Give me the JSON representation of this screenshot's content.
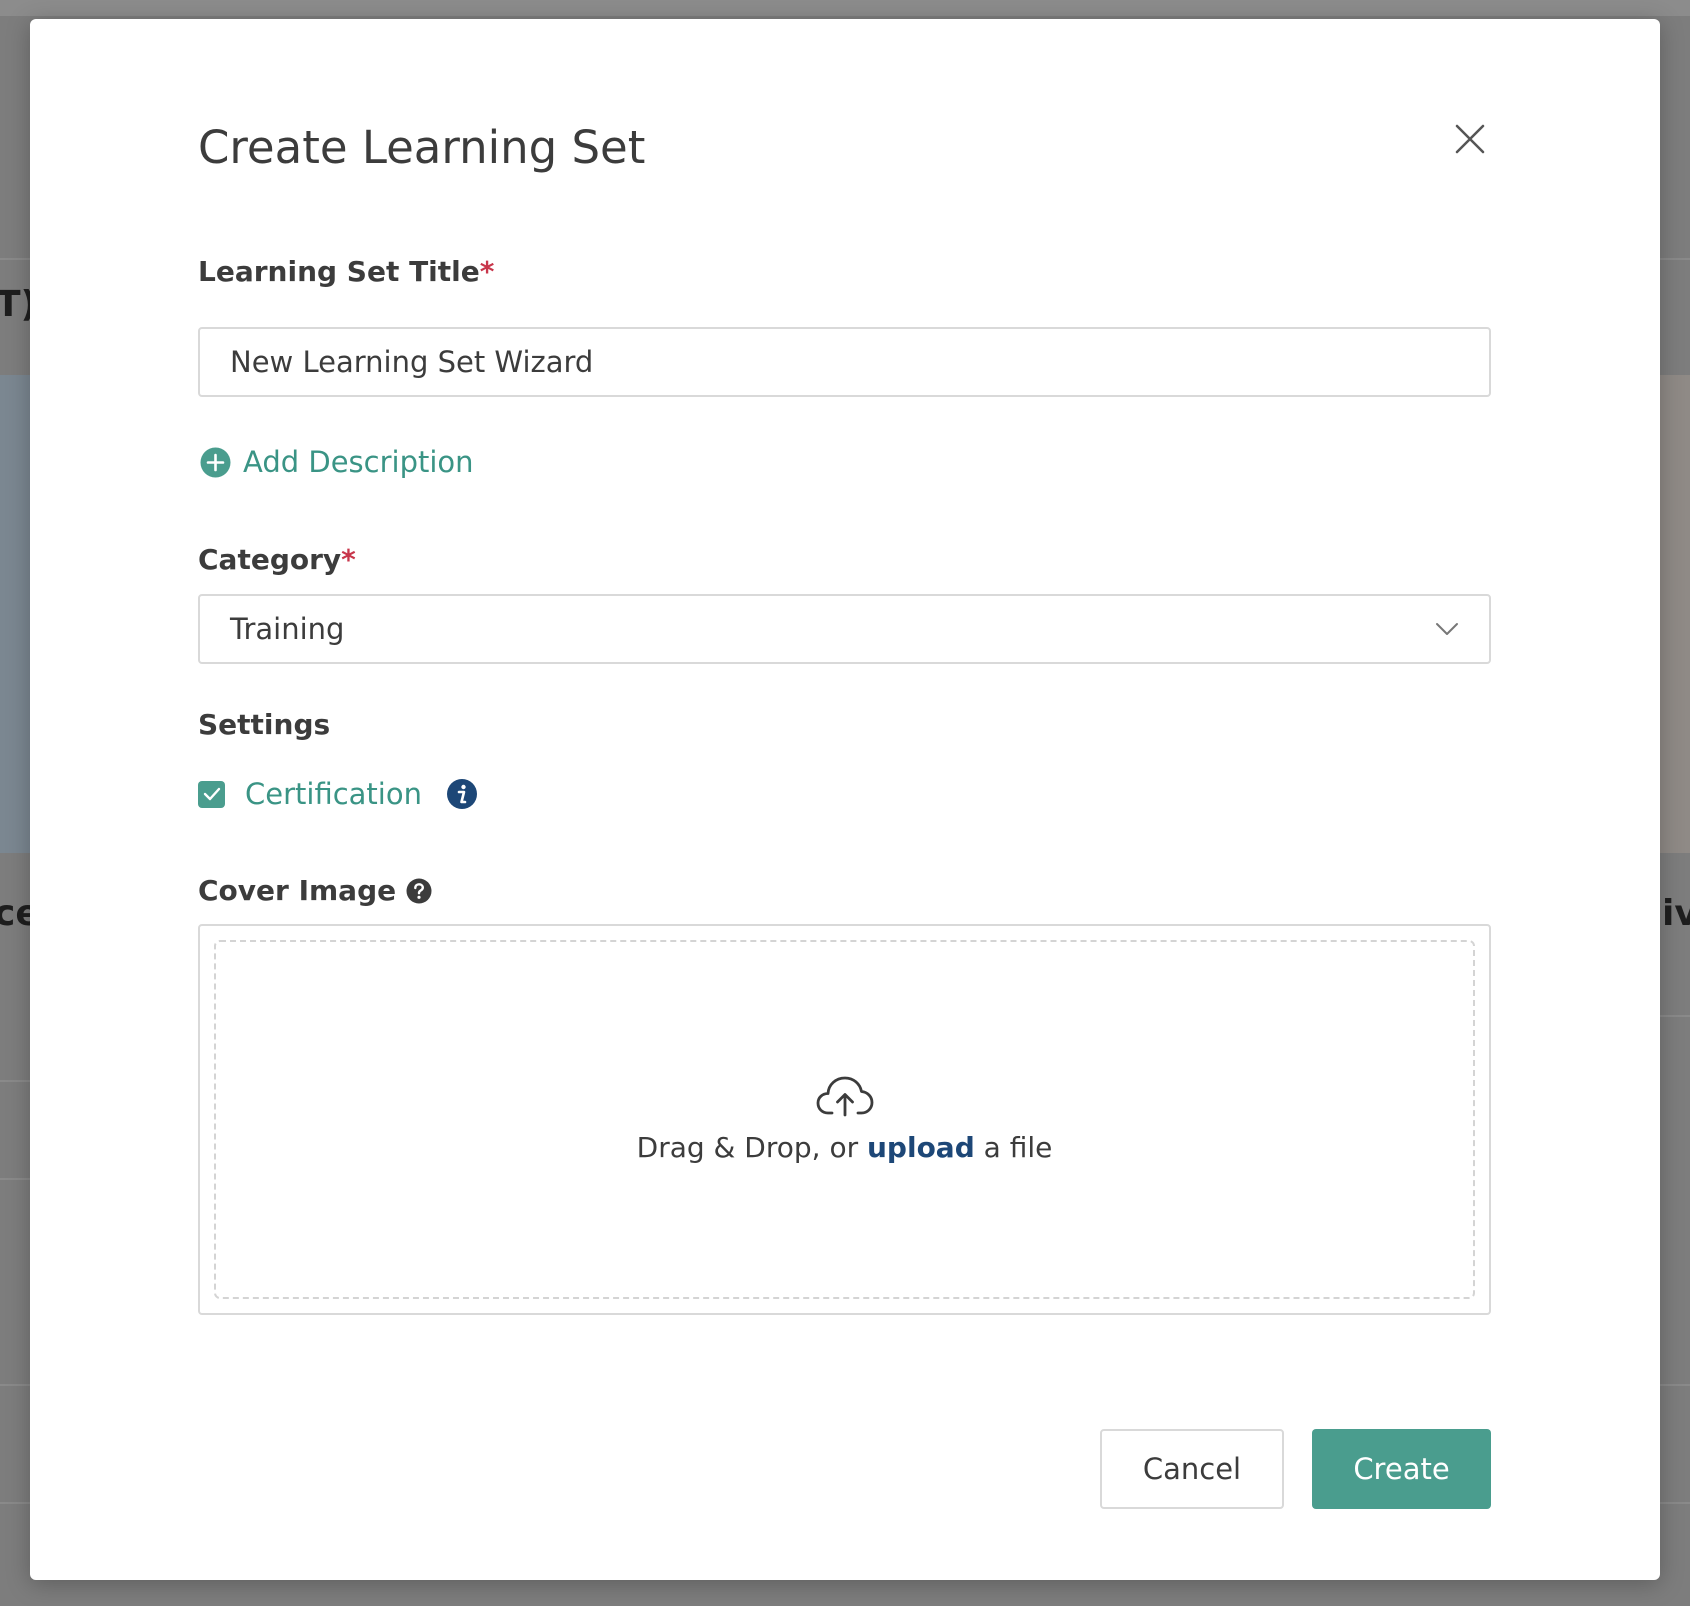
{
  "background": {
    "fragment_left_top": "T)",
    "fragment_left_mid": "ce",
    "fragment_right_mid": "iv"
  },
  "modal": {
    "title": "Create Learning Set",
    "close_icon": "close-icon"
  },
  "form": {
    "title_field": {
      "label": "Learning Set Title",
      "required_mark": "*",
      "value": "New Learning Set Wizard"
    },
    "add_description": {
      "label": "Add Description",
      "icon": "plus-circle-icon"
    },
    "category": {
      "label": "Category",
      "required_mark": "*",
      "value": "Training",
      "icon": "chevron-down-icon"
    },
    "settings": {
      "label": "Settings",
      "certification": {
        "label": "Certification",
        "checked": true,
        "icon": "info-icon"
      }
    },
    "cover_image": {
      "label": "Cover Image",
      "help_icon": "question-circle-icon",
      "upload_icon": "cloud-upload-icon",
      "drop_text_prefix": "Drag & Drop, or",
      "upload_link": "upload",
      "drop_text_suffix": "a file"
    }
  },
  "actions": {
    "cancel_label": "Cancel",
    "create_label": "Create"
  },
  "colors": {
    "accent": "#4a9d8e",
    "link_dark": "#1d4777",
    "required": "#c8364b",
    "overlay": "#7d7d7d"
  }
}
